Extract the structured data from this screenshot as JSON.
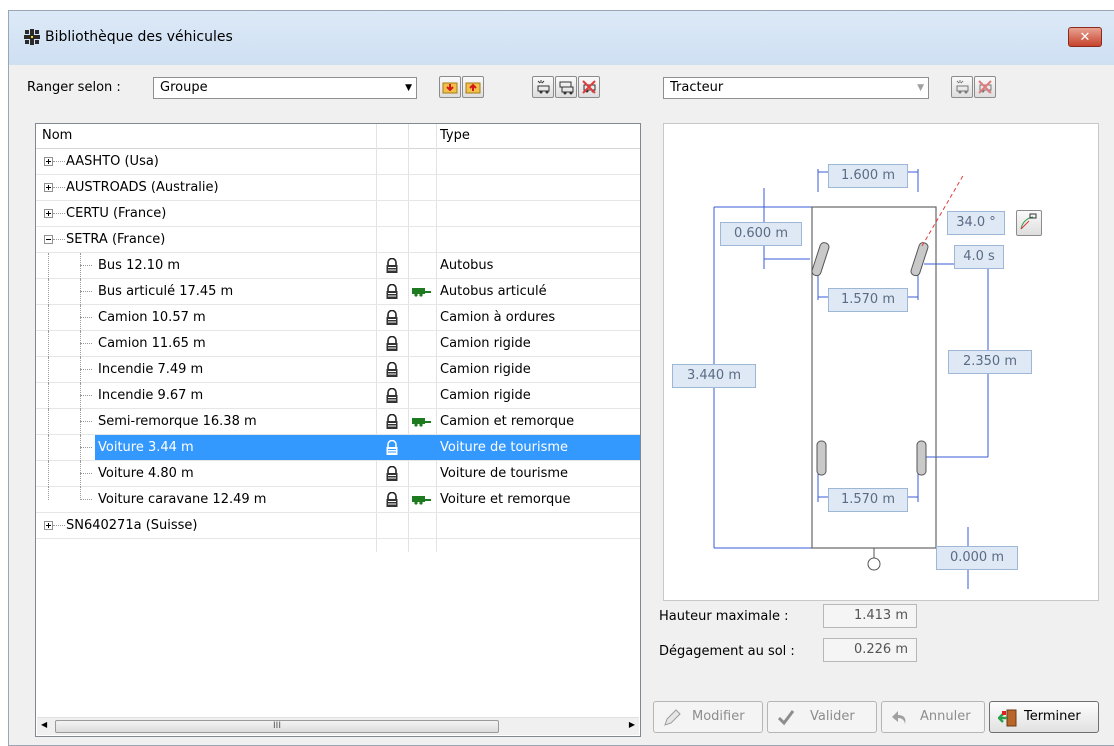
{
  "window": {
    "title": "Bibliothèque des véhicules",
    "close_label": "✕"
  },
  "left": {
    "sort_label": "Ranger selon :",
    "sort_value": "Groupe",
    "columns": {
      "name": "Nom",
      "type": "Type"
    },
    "scroll_thumb": "III",
    "tree": [
      {
        "label": "AASHTO (Usa)",
        "kind": "group",
        "expanded": false
      },
      {
        "label": "AUSTROADS (Australie)",
        "kind": "group",
        "expanded": false
      },
      {
        "label": "CERTU (France)",
        "kind": "group",
        "expanded": false
      },
      {
        "label": "SETRA (France)",
        "kind": "group",
        "expanded": true
      },
      {
        "label": "Bus 12.10 m",
        "kind": "item",
        "locked": true,
        "trailer": false,
        "type": "Autobus"
      },
      {
        "label": "Bus articulé 17.45 m",
        "kind": "item",
        "locked": true,
        "trailer": true,
        "type": "Autobus articulé"
      },
      {
        "label": "Camion 10.57 m",
        "kind": "item",
        "locked": true,
        "trailer": false,
        "type": "Camion à ordures"
      },
      {
        "label": "Camion 11.65 m",
        "kind": "item",
        "locked": true,
        "trailer": false,
        "type": "Camion rigide"
      },
      {
        "label": "Incendie 7.49 m",
        "kind": "item",
        "locked": true,
        "trailer": false,
        "type": "Camion rigide"
      },
      {
        "label": "Incendie 9.67 m",
        "kind": "item",
        "locked": true,
        "trailer": false,
        "type": "Camion rigide"
      },
      {
        "label": "Semi-remorque 16.38 m",
        "kind": "item",
        "locked": true,
        "trailer": true,
        "type": "Camion et remorque"
      },
      {
        "label": "Voiture 3.44 m",
        "kind": "item",
        "locked": true,
        "trailer": false,
        "type": "Voiture de tourisme",
        "selected": true
      },
      {
        "label": "Voiture 4.80 m",
        "kind": "item",
        "locked": true,
        "trailer": false,
        "type": "Voiture de tourisme"
      },
      {
        "label": "Voiture caravane 12.49 m",
        "kind": "item",
        "locked": true,
        "trailer": true,
        "type": "Voiture et remorque",
        "last": true
      },
      {
        "label": "SN640271a (Suisse)",
        "kind": "group",
        "expanded": false
      }
    ]
  },
  "right": {
    "unit_value": "Tracteur",
    "dims": {
      "width_top": "1.600 m",
      "front_overhang": "0.600 m",
      "angle": "34.0 °",
      "time": "4.0 s",
      "front_track": "1.570 m",
      "wheelbase": "2.350 m",
      "total_length": "3.440 m",
      "rear_track": "1.570 m",
      "hitch": "0.000 m"
    },
    "max_height_label": "Hauteur maximale :",
    "max_height_value": "1.413 m",
    "ground_clearance_label": "Dégagement au sol :",
    "ground_clearance_value": "0.226 m"
  },
  "buttons": {
    "modify": "Modifier",
    "validate": "Valider",
    "cancel": "Annuler",
    "finish": "Terminer"
  },
  "colors": {
    "selection": "#3399ff",
    "dim_line": "#3a5bd9",
    "dim_box_bg": "#dfe9f6"
  }
}
